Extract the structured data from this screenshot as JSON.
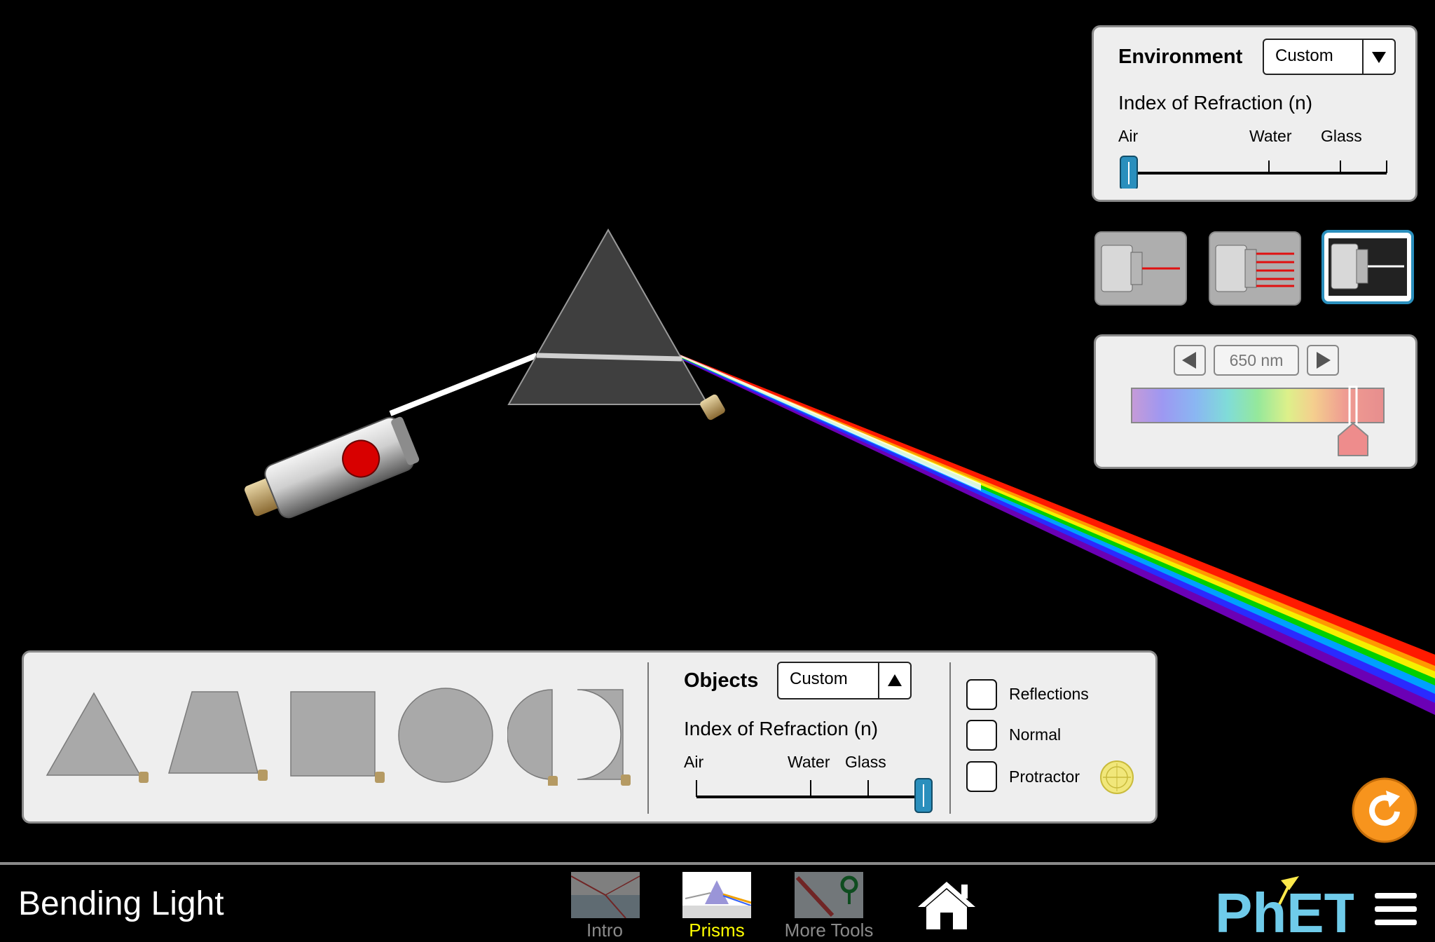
{
  "environment": {
    "title": "Environment",
    "medium_selected": "Custom",
    "index_label": "Index of Refraction (n)",
    "ticks": [
      "Air",
      "Water",
      "Glass"
    ],
    "index_fraction": 0.0
  },
  "light_source": {
    "modes": [
      "single-ray-laser",
      "multiple-rays-laser",
      "white-light-beam"
    ],
    "selected_mode": "white-light-beam",
    "wavelength_text": "650 nm",
    "wavelength_nm": 650,
    "spectrum_fraction": 0.85
  },
  "objects_panel": {
    "title": "Objects",
    "medium_selected": "Custom",
    "index_label": "Index of Refraction (n)",
    "ticks": [
      "Air",
      "Water",
      "Glass"
    ],
    "index_fraction": 1.0,
    "shapes": [
      "triangle",
      "trapezoid",
      "square",
      "circle",
      "semicircle",
      "diverging-lens"
    ]
  },
  "options": {
    "reflections": {
      "label": "Reflections",
      "checked": false
    },
    "normal": {
      "label": "Normal",
      "checked": false
    },
    "protractor": {
      "label": "Protractor",
      "checked": false
    }
  },
  "navbar": {
    "title": "Bending Light",
    "screens": [
      {
        "label": "Intro",
        "selected": false
      },
      {
        "label": "Prisms",
        "selected": true
      },
      {
        "label": "More Tools",
        "selected": false
      }
    ],
    "logo": "PhET"
  },
  "colors": {
    "nav_selected": "#ffff00",
    "nav_unselected": "#8a8a8a",
    "slider_thumb": "#2a8fbd",
    "reset": "#f7941d",
    "laser_button": "#d80000",
    "phet_blue": "#6fcbea",
    "phet_yellow": "#fde94b"
  }
}
